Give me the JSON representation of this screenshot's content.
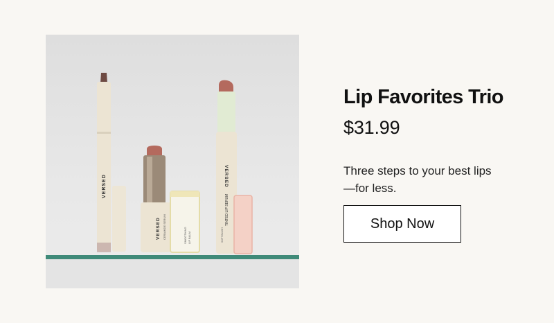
{
  "product": {
    "image_alt": "Versed lip products on a glass shelf",
    "brand_text": "VERSED",
    "name": "Lip Favorites Trio",
    "price": "$31.99",
    "description": "Three steps to your best lips—for less.",
    "cta_label": "Shop Now",
    "item_labels": {
      "balm_line1": "CERAMIDE SERUM",
      "balm_line2": "SMOOTHING",
      "balm_line3": "LIP BALM",
      "serum_line1": "TINTED LIP SERUM",
      "serum_line2": "SOFT BLUSH"
    }
  },
  "colors": {
    "background": "#f9f7f3",
    "shelf": "#3f8a79",
    "tube": "#ece4d3",
    "lipstick": "#b46a5e",
    "pencil_tip": "#6e4a43"
  }
}
